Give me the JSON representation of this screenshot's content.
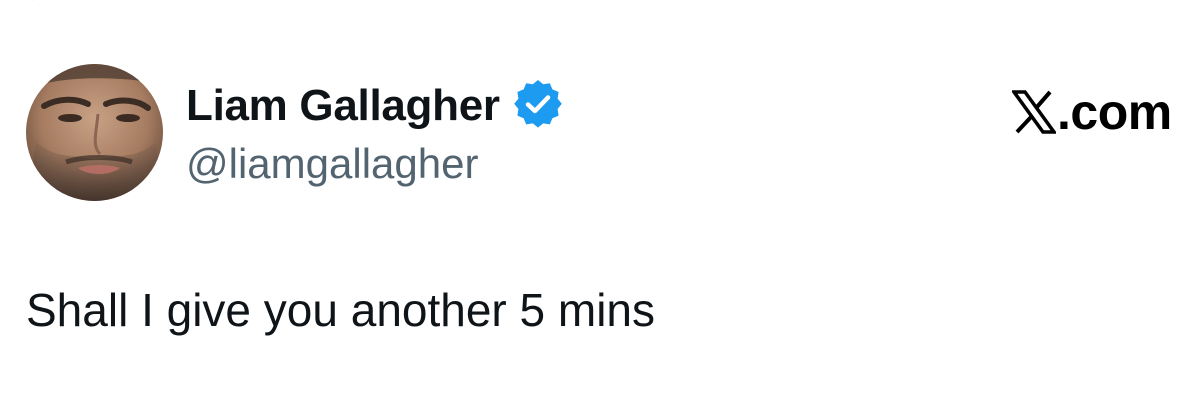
{
  "tweet": {
    "author": {
      "display_name": "Liam Gallagher",
      "handle": "@liamgallagher",
      "verified": true,
      "verified_icon": "verified-badge-icon",
      "avatar_icon": "avatar-photo"
    },
    "text": "Shall I give you another 5 mins"
  },
  "brand": {
    "logo_icon": "x-logo-icon",
    "label": ".com"
  },
  "colors": {
    "name_text": "#0f1419",
    "handle_text": "#536471",
    "verified_blue": "#1d9bf0",
    "background": "#ffffff"
  }
}
